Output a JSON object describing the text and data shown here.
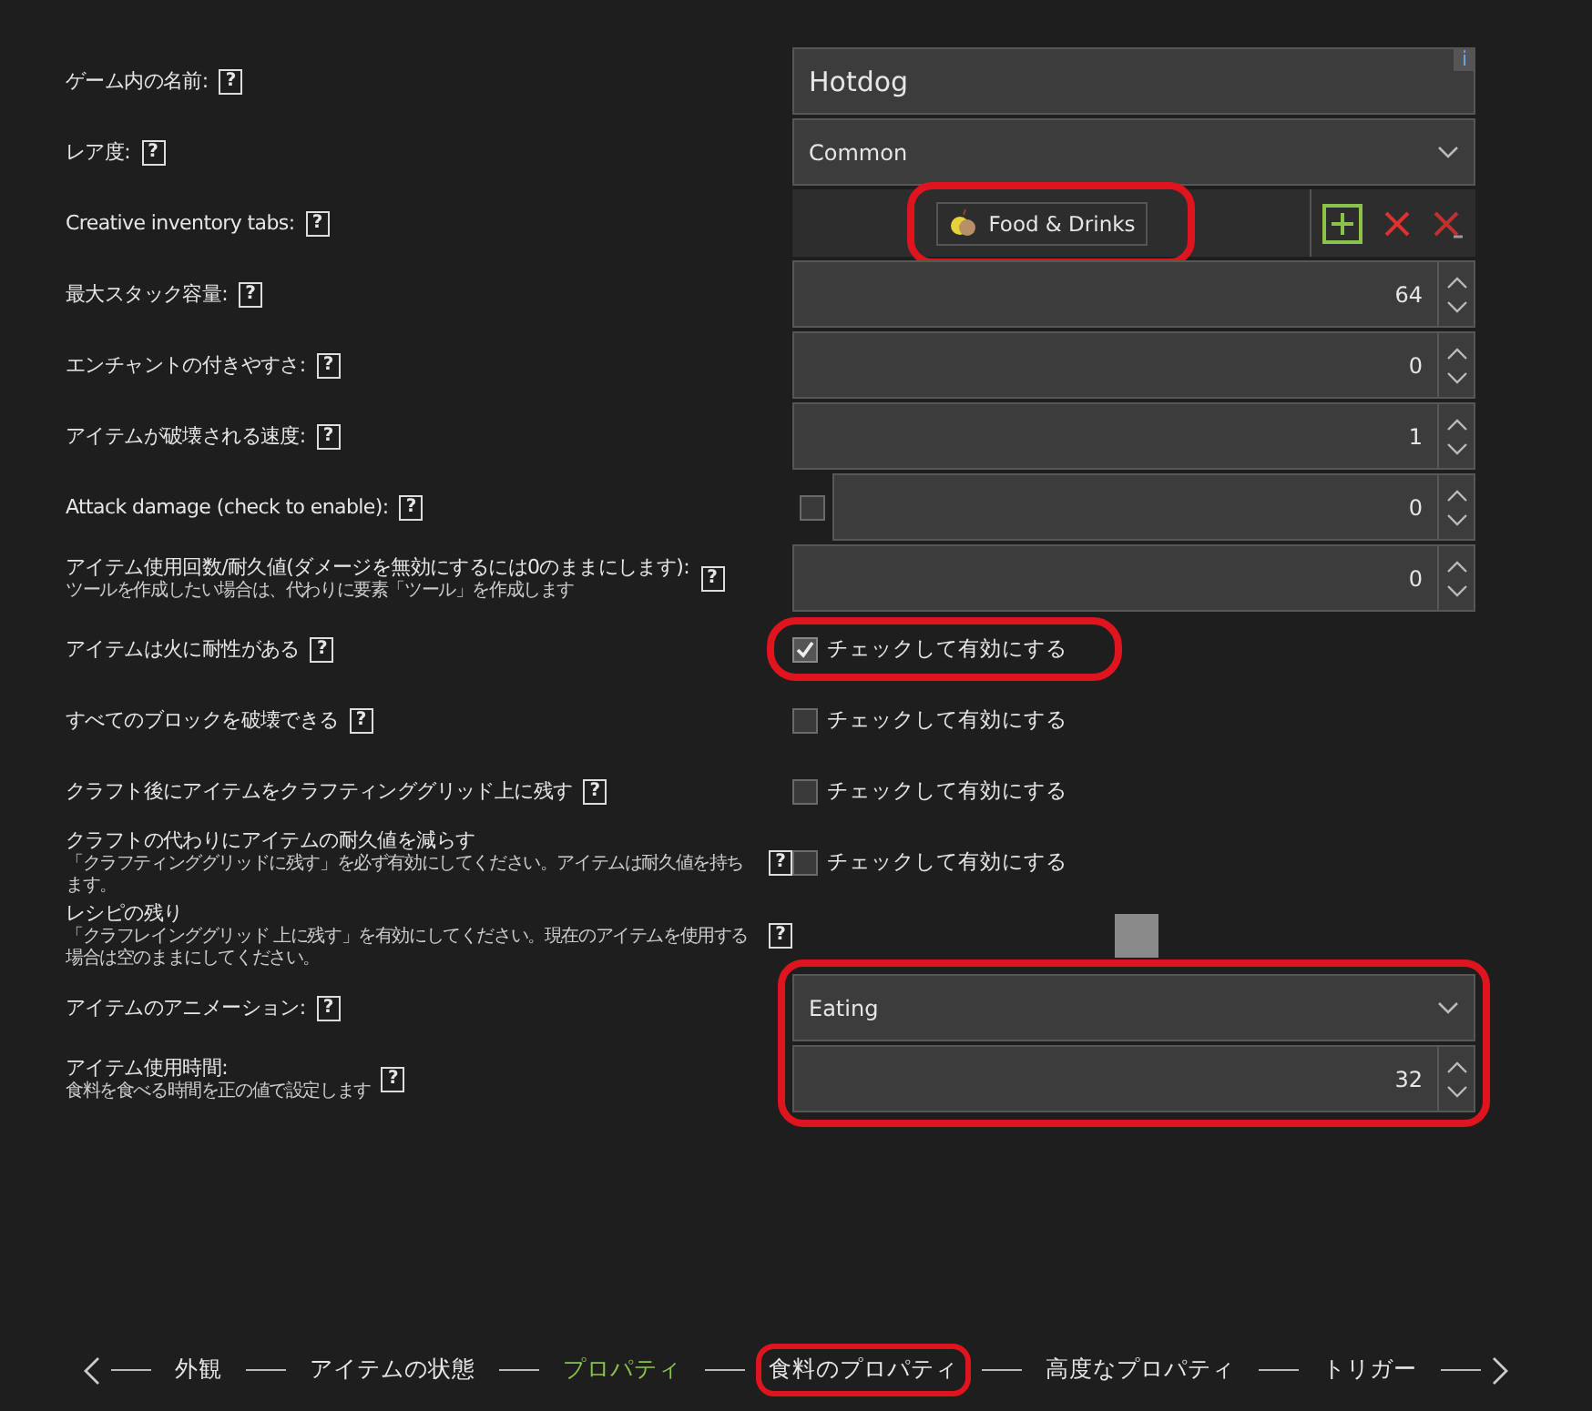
{
  "rows": [
    {
      "kind": "text",
      "label": "ゲーム内の名前:",
      "help": "?",
      "value": "Hotdog",
      "info": "i",
      "annotated": false
    },
    {
      "kind": "dropdown",
      "label": "レア度:",
      "help": "?",
      "value": "Common",
      "annotated": false
    },
    {
      "kind": "tabs",
      "label": "Creative inventory tabs:",
      "help": "?",
      "chips": [
        "Food & Drinks"
      ],
      "annotated": true
    },
    {
      "kind": "spinner",
      "label": "最大スタック容量:",
      "help": "?",
      "value": "64",
      "annotated": false
    },
    {
      "kind": "spinner",
      "label": "エンチャントの付きやすさ:",
      "help": "?",
      "value": "0",
      "annotated": false
    },
    {
      "kind": "spinner",
      "label": "アイテムが破壊される速度:",
      "help": "?",
      "value": "1",
      "annotated": false
    },
    {
      "kind": "check-spinner",
      "label": "Attack damage (check to enable):",
      "help": "?",
      "value": "0",
      "checked": false,
      "annotated": false
    },
    {
      "kind": "spinner",
      "label": "アイテム使用回数/耐久値(ダメージを無効にするには0のままにします):",
      "sublabel": "ツールを作成したい場合は、代わりに要素「ツール」を作成します",
      "help": "?",
      "value": "0",
      "annotated": false
    },
    {
      "kind": "checkbox",
      "label": "アイテムは火に耐性がある",
      "help": "?",
      "text": "チェックして有効にする",
      "checked": true,
      "annotated": true
    },
    {
      "kind": "checkbox",
      "label": "すべてのブロックを破壊できる",
      "help": "?",
      "text": "チェックして有効にする",
      "checked": false,
      "annotated": false
    },
    {
      "kind": "checkbox",
      "label": "クラフト後にアイテムをクラフティンググリッド上に残す",
      "help": "?",
      "text": "チェックして有効にする",
      "checked": false,
      "annotated": false
    },
    {
      "kind": "checkbox",
      "label": "クラフトの代わりにアイテムの耐久値を減らす",
      "sublabel": "「クラフティンググリッドに残す」を必ず有効にしてください。アイテムは耐久値を持ちます。",
      "help": "?",
      "text": "チェックして有効にする",
      "checked": false,
      "annotated": false
    },
    {
      "kind": "slot",
      "label": "レシピの残り",
      "sublabel": "「クラフレインググリッド 上に残す」を有効にしてください。現在のアイテムを使用する場合は空のままにしてください。",
      "help": "?",
      "annotated": false
    },
    {
      "kind": "group",
      "annotated": true,
      "rows": [
        {
          "kind": "dropdown",
          "label": "アイテムのアニメーション:",
          "help": "?",
          "value": "Eating"
        },
        {
          "kind": "spinner",
          "label": "アイテム使用時間:",
          "sublabel": "食料を食べる時間を正の値で設定します",
          "help": "?",
          "value": "32"
        }
      ]
    }
  ],
  "nav": {
    "steps": [
      {
        "label": "外観",
        "selected": false,
        "annotated": false
      },
      {
        "label": "アイテムの状態",
        "selected": false,
        "annotated": false
      },
      {
        "label": "プロパティ",
        "selected": true,
        "annotated": false
      },
      {
        "label": "食料のプロパティ",
        "selected": false,
        "annotated": true
      },
      {
        "label": "高度なプロパティ",
        "selected": false,
        "annotated": false
      },
      {
        "label": "トリガー",
        "selected": false,
        "annotated": false
      }
    ]
  }
}
